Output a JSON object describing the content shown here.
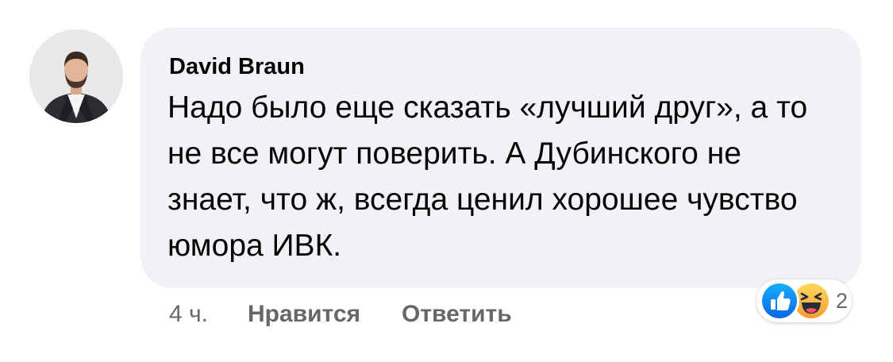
{
  "comment": {
    "author": "David Braun",
    "text": "Надо было еще сказать «лучший друг», а то не все могут поверить. А Дубинского не знает, что ж, всегда ценил хорошее чувство юмора ИВК."
  },
  "actions": {
    "time": "4 ч.",
    "like_label": "Нравится",
    "reply_label": "Ответить"
  },
  "reactions": {
    "icons": [
      "like-icon",
      "haha-icon"
    ],
    "count": "2"
  },
  "colors": {
    "bubble": "#f0f2f5",
    "text": "#050505",
    "secondary_text": "#65676b",
    "like_blue": "#1877f2",
    "haha_yellow": "#f7b125"
  }
}
